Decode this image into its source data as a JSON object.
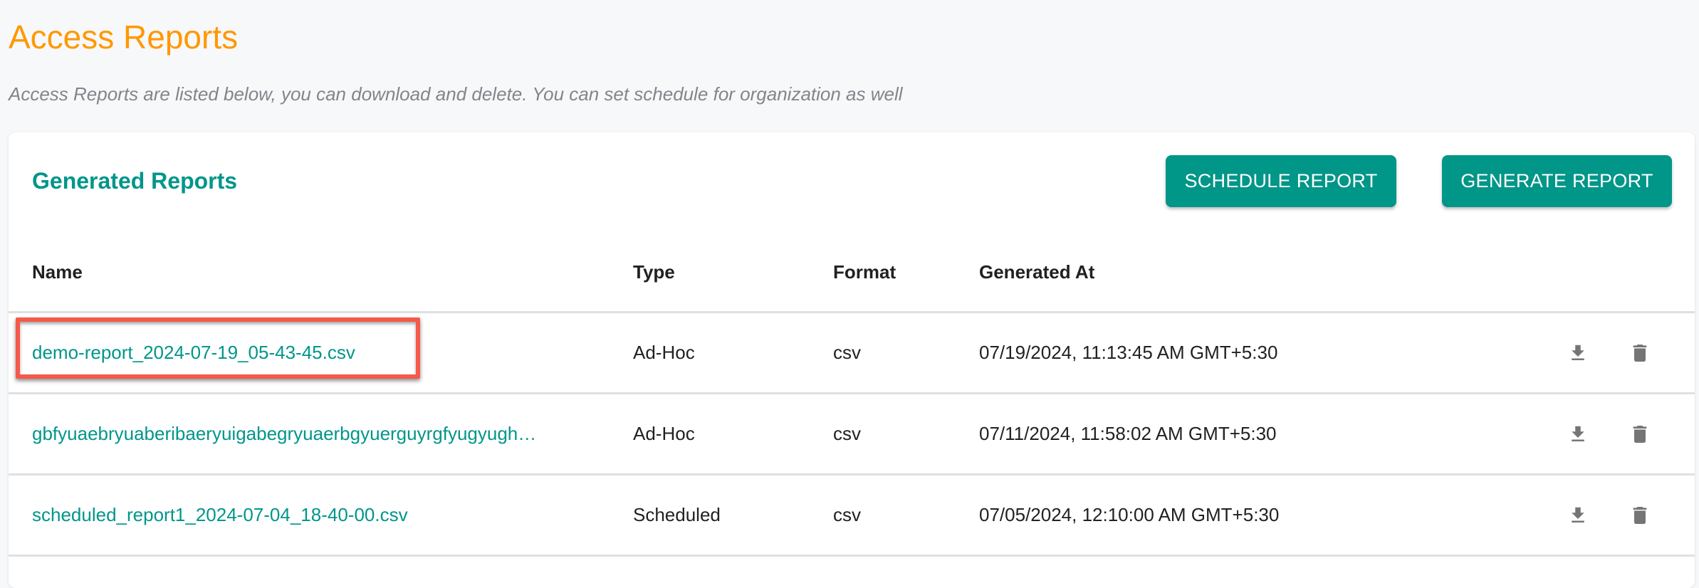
{
  "page": {
    "title": "Access Reports",
    "subtitle": "Access Reports are listed below, you can download and delete. You can set schedule for organization as well"
  },
  "card": {
    "title": "Generated Reports",
    "schedule_button": "SCHEDULE REPORT",
    "generate_button": "GENERATE REPORT"
  },
  "table": {
    "columns": [
      "Name",
      "Type",
      "Format",
      "Generated At"
    ],
    "rows": [
      {
        "name": "demo-report_2024-07-19_05-43-45.csv",
        "type": "Ad-Hoc",
        "format": "csv",
        "generated_at": "07/19/2024, 11:13:45 AM GMT+5:30",
        "highlighted": true
      },
      {
        "name": "gbfyuaebryuaberibaeryuigabegryuaerbgyuerguyrgfyugyugh…",
        "type": "Ad-Hoc",
        "format": "csv",
        "generated_at": "07/11/2024, 11:58:02 AM GMT+5:30",
        "highlighted": false
      },
      {
        "name": "scheduled_report1_2024-07-04_18-40-00.csv",
        "type": "Scheduled",
        "format": "csv",
        "generated_at": "07/05/2024, 12:10:00 AM GMT+5:30",
        "highlighted": false
      }
    ],
    "row_actions": [
      "download-icon",
      "delete-icon"
    ]
  },
  "colors": {
    "title": "#ff9800",
    "accent": "#009688",
    "highlight": "#f5594a",
    "icon": "#757575"
  }
}
